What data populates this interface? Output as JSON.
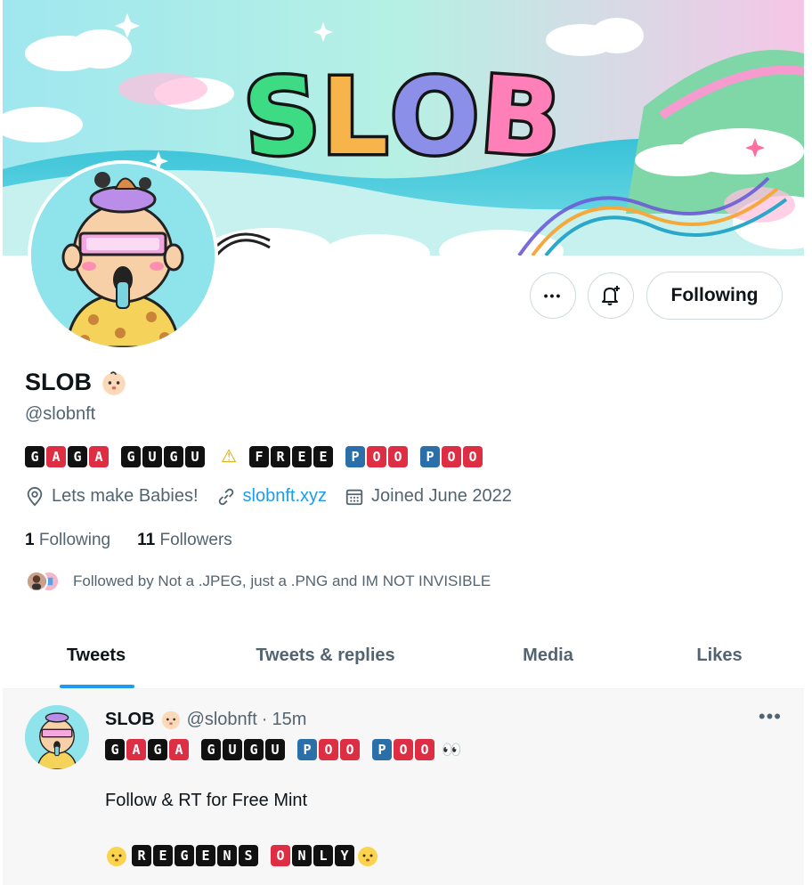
{
  "banner": {
    "title_letters": [
      "S",
      "L",
      "O",
      "B"
    ]
  },
  "actions": {
    "more_label": "•••",
    "bell_label": "notify",
    "following_label": "Following"
  },
  "profile": {
    "display_name": "SLOB",
    "handle": "@slobnft",
    "bio": [
      {
        "type": "tiles",
        "style": "k",
        "text": "G"
      },
      {
        "type": "tiles",
        "style": "r",
        "text": "A"
      },
      {
        "type": "tiles",
        "style": "k",
        "text": "G"
      },
      {
        "type": "tiles",
        "style": "r",
        "text": "A"
      },
      {
        "type": "gap"
      },
      {
        "type": "tiles",
        "style": "k",
        "text": "G"
      },
      {
        "type": "tiles",
        "style": "k",
        "text": "U"
      },
      {
        "type": "tiles",
        "style": "k",
        "text": "G"
      },
      {
        "type": "tiles",
        "style": "k",
        "text": "U"
      },
      {
        "type": "gap"
      },
      {
        "type": "warn",
        "text": "⚠"
      },
      {
        "type": "tiles",
        "style": "k",
        "text": "F"
      },
      {
        "type": "tiles",
        "style": "k",
        "text": "R"
      },
      {
        "type": "tiles",
        "style": "k",
        "text": "E"
      },
      {
        "type": "tiles",
        "style": "k",
        "text": "E"
      },
      {
        "type": "gap"
      },
      {
        "type": "tiles",
        "style": "b",
        "text": "P"
      },
      {
        "type": "tiles",
        "style": "r",
        "text": "O"
      },
      {
        "type": "tiles",
        "style": "r",
        "text": "O"
      },
      {
        "type": "gap"
      },
      {
        "type": "tiles",
        "style": "b",
        "text": "P"
      },
      {
        "type": "tiles",
        "style": "r",
        "text": "O"
      },
      {
        "type": "tiles",
        "style": "r",
        "text": "O"
      }
    ],
    "location": "Lets make Babies!",
    "website": "slobnft.xyz",
    "joined": "Joined June 2022",
    "following_count": "1",
    "following_label": "Following",
    "followers_count": "11",
    "followers_label": "Followers",
    "followed_by": "Followed by Not a .JPEG, just a .PNG and IM NOT INVISIBLE"
  },
  "tabs": [
    {
      "label": "Tweets",
      "active": true
    },
    {
      "label": "Tweets & replies",
      "active": false
    },
    {
      "label": "Media",
      "active": false
    },
    {
      "label": "Likes",
      "active": false
    }
  ],
  "tweet": {
    "name": "SLOB",
    "handle": "@slobnft",
    "separator": "·",
    "time": "15m",
    "more_label": "•••",
    "line1": [
      {
        "style": "k",
        "text": "G"
      },
      {
        "style": "r",
        "text": "A"
      },
      {
        "style": "k",
        "text": "G"
      },
      {
        "style": "r",
        "text": "A"
      },
      {
        "gap": true
      },
      {
        "style": "k",
        "text": "G"
      },
      {
        "style": "k",
        "text": "U"
      },
      {
        "style": "k",
        "text": "G"
      },
      {
        "style": "k",
        "text": "U"
      },
      {
        "gap": true
      },
      {
        "style": "b",
        "text": "P"
      },
      {
        "style": "r",
        "text": "O"
      },
      {
        "style": "r",
        "text": "O"
      },
      {
        "gap": true
      },
      {
        "style": "b",
        "text": "P"
      },
      {
        "style": "r",
        "text": "O"
      },
      {
        "style": "r",
        "text": "O"
      }
    ],
    "eyes": "👀",
    "body": "Follow & RT for Free Mint",
    "line3": [
      {
        "style": "k",
        "text": "R"
      },
      {
        "style": "k",
        "text": "E"
      },
      {
        "style": "k",
        "text": "G"
      },
      {
        "style": "k",
        "text": "E"
      },
      {
        "style": "k",
        "text": "N"
      },
      {
        "style": "k",
        "text": "S"
      },
      {
        "gap": true
      },
      {
        "style": "r",
        "text": "O"
      },
      {
        "style": "k",
        "text": "N"
      },
      {
        "style": "k",
        "text": "L"
      },
      {
        "style": "k",
        "text": "Y"
      }
    ]
  },
  "colors": {
    "accent": "#1d9bf0",
    "muted": "#536471",
    "tile_red": "#dd2e44",
    "tile_blue": "#2b6fa8",
    "tile_black": "#111111"
  },
  "icons": {
    "location": "location-pin-icon",
    "link": "link-icon",
    "calendar": "calendar-icon",
    "bell": "bell-plus-icon",
    "more": "more-horizontal-icon",
    "verified_emoji": "baby-face-icon"
  }
}
